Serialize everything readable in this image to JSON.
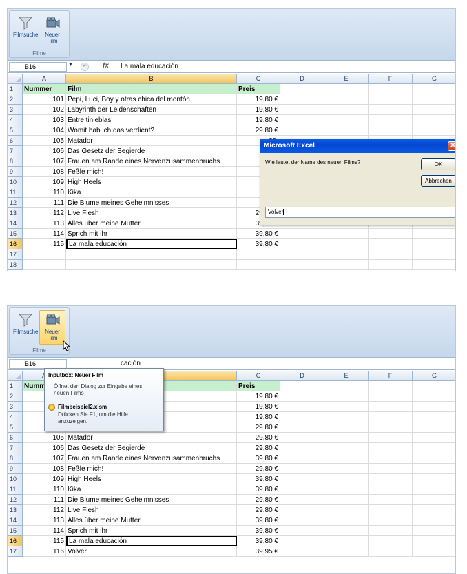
{
  "ribbon": {
    "filmsuche_label": "Filmsuche",
    "neuer_film_label_1": "Neuer",
    "neuer_film_label_2": "Film",
    "group_label": "Filme",
    "filter_icon": "filter-funnel-icon",
    "camera_icon": "film-camera-icon"
  },
  "formula_bar": {
    "name_box": "B16",
    "fx_label": "fx",
    "value_top": "La mala educación",
    "value_bottom": "cación"
  },
  "columns": [
    "A",
    "B",
    "C",
    "D",
    "E",
    "F",
    "G"
  ],
  "headers": {
    "nummer": "Nummer",
    "film": "Film",
    "preis": "Preis"
  },
  "rows_top": [
    {
      "row": "2",
      "num": "101",
      "film": "Pepi, Luci, Boy y otras chica del montón",
      "price": "19,80 €"
    },
    {
      "row": "3",
      "num": "102",
      "film": "Labyrinth der Leidenschaften",
      "price": "19,80 €"
    },
    {
      "row": "4",
      "num": "103",
      "film": "Entre tinieblas",
      "price": "19,80 €"
    },
    {
      "row": "5",
      "num": "104",
      "film": "Womit hab ich das verdient?",
      "price": "29,80 €"
    },
    {
      "row": "6",
      "num": "105",
      "film": "Matador",
      "price": "29,"
    },
    {
      "row": "7",
      "num": "106",
      "film": "Das Gesetz der Begierde",
      "price": "29,"
    },
    {
      "row": "8",
      "num": "107",
      "film": "Frauen am Rande eines Nervenzusammenbruchs",
      "price": "39,"
    },
    {
      "row": "9",
      "num": "108",
      "film": "Feßle mich!",
      "price": "29,"
    },
    {
      "row": "10",
      "num": "109",
      "film": "High Heels",
      "price": "39,"
    },
    {
      "row": "11",
      "num": "110",
      "film": "Kika",
      "price": "39,"
    },
    {
      "row": "12",
      "num": "111",
      "film": "Die Blume meines Geheimnisses",
      "price": "29,"
    },
    {
      "row": "13",
      "num": "112",
      "film": "Live Flesh",
      "price": "29,80 €"
    },
    {
      "row": "14",
      "num": "113",
      "film": "Alles über meine Mutter",
      "price": "39,80 €"
    },
    {
      "row": "15",
      "num": "114",
      "film": "Sprich mit ihr",
      "price": "39,80 €"
    },
    {
      "row": "16",
      "num": "115",
      "film": "La mala educación",
      "price": "39,80 €"
    },
    {
      "row": "17",
      "num": "",
      "film": "",
      "price": ""
    },
    {
      "row": "18",
      "num": "",
      "film": "",
      "price": ""
    }
  ],
  "rows_bottom": [
    {
      "row": "2",
      "num": "",
      "film": "del montón",
      "price": "19,80 €"
    },
    {
      "row": "3",
      "num": "",
      "film": "",
      "price": "19,80 €"
    },
    {
      "row": "4",
      "num": "",
      "film": "",
      "price": "19,80 €"
    },
    {
      "row": "5",
      "num": "104",
      "film": "Womit hab ich das verdient?",
      "price": "29,80 €"
    },
    {
      "row": "6",
      "num": "105",
      "film": "Matador",
      "price": "29,80 €"
    },
    {
      "row": "7",
      "num": "106",
      "film": "Das Gesetz der Begierde",
      "price": "29,80 €"
    },
    {
      "row": "8",
      "num": "107",
      "film": "Frauen am Rande eines Nervenzusammenbruchs",
      "price": "39,80 €"
    },
    {
      "row": "9",
      "num": "108",
      "film": "Feßle mich!",
      "price": "29,80 €"
    },
    {
      "row": "10",
      "num": "109",
      "film": "High Heels",
      "price": "39,80 €"
    },
    {
      "row": "11",
      "num": "110",
      "film": "Kika",
      "price": "39,80 €"
    },
    {
      "row": "12",
      "num": "111",
      "film": "Die Blume meines Geheimnisses",
      "price": "29,80 €"
    },
    {
      "row": "13",
      "num": "112",
      "film": "Live Flesh",
      "price": "29,80 €"
    },
    {
      "row": "14",
      "num": "113",
      "film": "Alles über meine Mutter",
      "price": "39,80 €"
    },
    {
      "row": "15",
      "num": "114",
      "film": "Sprich mit ihr",
      "price": "39,80 €"
    },
    {
      "row": "16",
      "num": "115",
      "film": "La mala educación",
      "price": "39,80 €"
    },
    {
      "row": "17",
      "num": "116",
      "film": "Volver",
      "price": "39,95 €"
    }
  ],
  "dialog": {
    "title": "Microsoft Excel",
    "prompt": "Wie lautet der Name des neuen Films?",
    "ok": "OK",
    "cancel": "Abbrechen",
    "input_value": "Volver",
    "close_icon": "close-icon"
  },
  "tooltip": {
    "title": "Inputbox: Neuer Film",
    "text": "Öffnet den Dialog zur Eingabe eines neuen Films",
    "file": "Filmbeispiel2.xlsm",
    "help": "Drücken Sie F1, um die Hilfe anzuzeigen."
  },
  "colors": {
    "header_green": "#c6efce",
    "selection_orange": "#f2c45b",
    "dialog_title_blue": "#0a5ce6"
  }
}
